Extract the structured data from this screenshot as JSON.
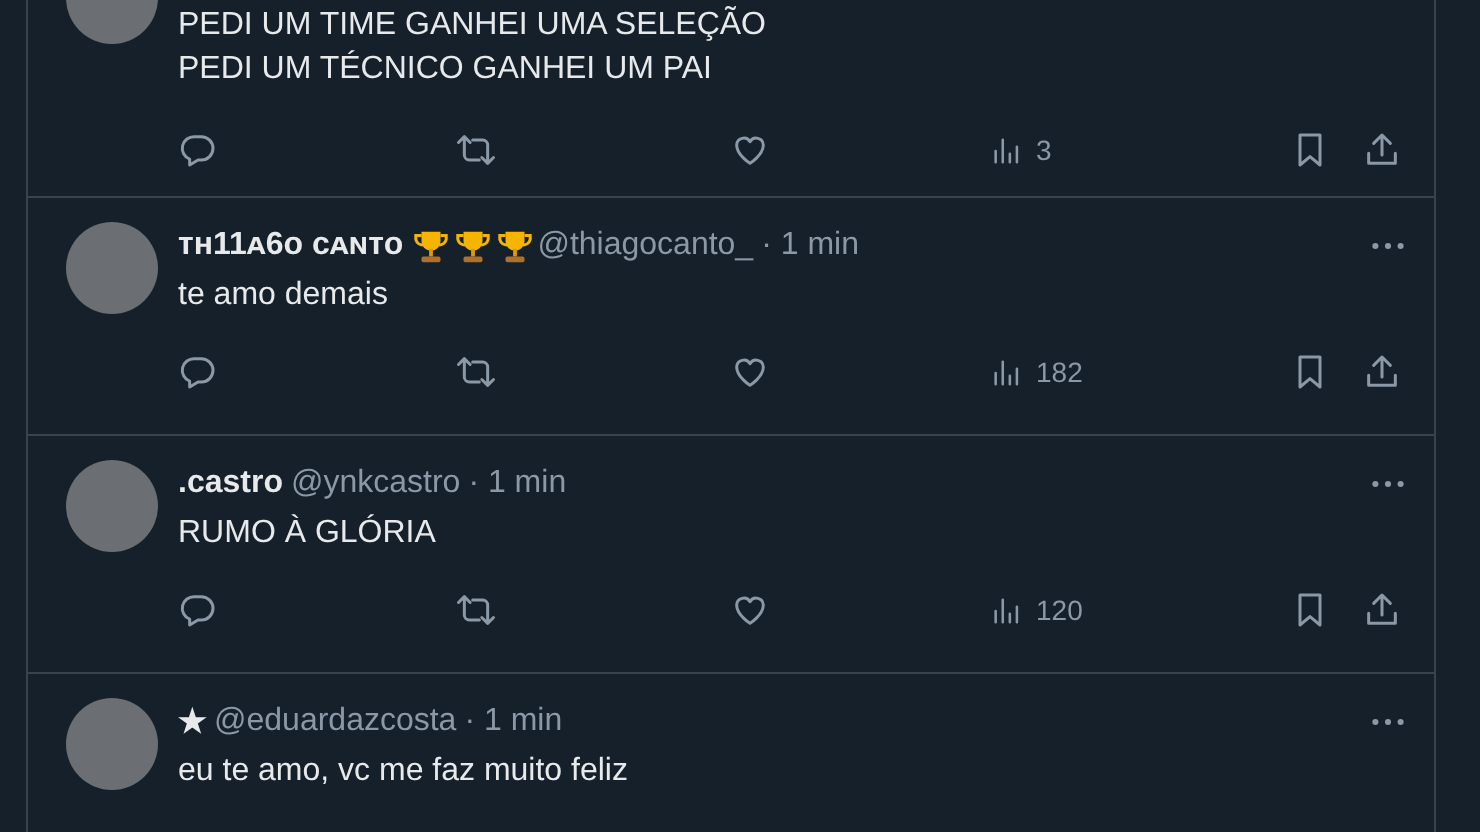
{
  "posts": [
    {
      "text_lines": [
        "PEDI UM TIME GANHEI UMA SELEÇÃO",
        "PEDI UM TÉCNICO GANHEI UM PAI"
      ],
      "views": "3"
    },
    {
      "name": "ᴛʜ11ᴀ6ᴏ ᴄᴀɴᴛᴏ",
      "badges": [
        {
          "kind": "trophy"
        },
        {
          "kind": "trophy"
        },
        {
          "kind": "trophy"
        }
      ],
      "handle": "@thiagocanto_",
      "time": "· 1 min",
      "text_lines": [
        "te amo demais"
      ],
      "views": "182"
    },
    {
      "name": ".castro",
      "handle": "@ynkcastro",
      "time": "· 1 min",
      "text_lines": [
        "RUMO À GLÓRIA"
      ],
      "views": "120"
    },
    {
      "name": "★",
      "handle": "@eduardazcosta",
      "time": "· 1 min",
      "text_lines": [
        "eu te amo, vc me faz muito feliz"
      ]
    }
  ]
}
